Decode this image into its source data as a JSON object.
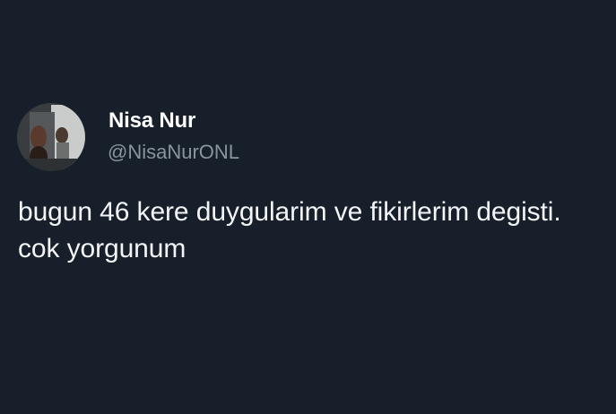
{
  "tweet": {
    "author": {
      "display_name": "Nisa Nur",
      "handle": "@NisaNurONL"
    },
    "text": "bugun 46 kere duygularim ve fikirlerim degisti. cok yorgunum"
  },
  "colors": {
    "background": "#161f2a",
    "name": "#ffffff",
    "handle": "#8a949e",
    "body_text": "#f2f4f5"
  }
}
